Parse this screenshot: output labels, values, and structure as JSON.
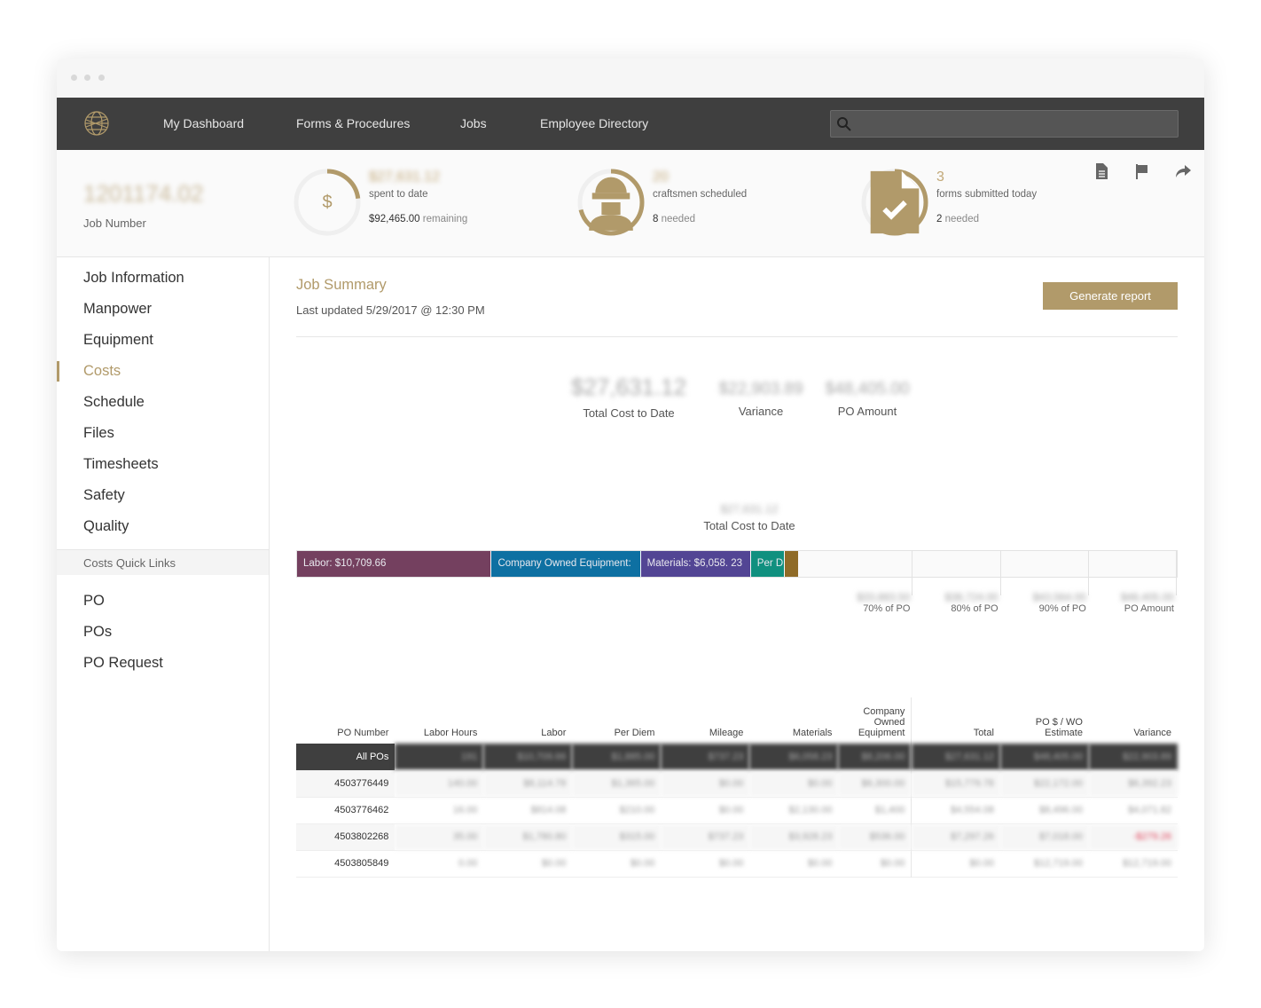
{
  "nav": {
    "items": [
      "My Dashboard",
      "Forms & Procedures",
      "Jobs",
      "Employee Directory"
    ],
    "search_placeholder": ""
  },
  "header": {
    "job_number": "1201174.02",
    "job_number_label": "Job Number",
    "stats": [
      {
        "icon": "dollar-icon",
        "value": "$27,631.12",
        "label": "spent to date",
        "extra_value": "$92,465.00",
        "extra_label": "remaining",
        "progress": 0.23
      },
      {
        "icon": "worker-icon",
        "value": "20",
        "label": "craftsmen scheduled",
        "extra_value": "8",
        "extra_label": "needed",
        "progress": 0.71
      },
      {
        "icon": "form-check-icon",
        "value": "3",
        "label": "forms submitted today",
        "extra_value": "2",
        "extra_label": "needed",
        "progress": 0.6
      }
    ],
    "actions": [
      "document-icon",
      "flag-icon",
      "share-icon"
    ]
  },
  "sidebar": {
    "items": [
      "Job Information",
      "Manpower",
      "Equipment",
      "Costs",
      "Schedule",
      "Files",
      "Timesheets",
      "Safety",
      "Quality"
    ],
    "active": "Costs",
    "quick_links_label": "Costs Quick Links",
    "quick_links": [
      "PO",
      "POs",
      "PO Request"
    ]
  },
  "main": {
    "title": "Job Summary",
    "updated": "Last updated 5/29/2017 @ 12:30 PM",
    "generate_label": "Generate report",
    "kpis": [
      {
        "value": "$27,631.12",
        "label": "Total Cost to Date"
      },
      {
        "value": "$22,903.89",
        "label": "Variance"
      },
      {
        "value": "$48,405.00",
        "label": "PO Amount"
      }
    ]
  },
  "chart_data": {
    "type": "bar",
    "stacked": true,
    "orientation": "horizontal",
    "total_value": "$27,631.12",
    "total_label": "Total Cost to Date",
    "xlim": [
      0,
      48405
    ],
    "series": [
      {
        "name": "Labor",
        "label": "Labor: $10,709.66",
        "value": 10709.66,
        "color": "#74405f"
      },
      {
        "name": "Company Owned Equipment",
        "label": "Company Owned Equipment:",
        "value": 8206.0,
        "color": "#0e70a2"
      },
      {
        "name": "Materials",
        "label": "Materials: $6,058. 23",
        "value": 6058.23,
        "color": "#524594"
      },
      {
        "name": "Per Diem",
        "label": "Per D",
        "value": 1885.0,
        "color": "#10907f"
      },
      {
        "name": "Mileage",
        "label": "",
        "value": 737.23,
        "color": "#8f6b28"
      }
    ],
    "thresholds": [
      {
        "value": 33883.5,
        "value_label": "$33,883.50",
        "label": "70% of PO"
      },
      {
        "value": 38724.0,
        "value_label": "$38,724.00",
        "label": "80% of PO"
      },
      {
        "value": 43564.0,
        "value_label": "$43,564.00",
        "label": "90% of PO"
      },
      {
        "value": 48405.0,
        "value_label": "$48,405.00",
        "label": "PO Amount"
      }
    ]
  },
  "table": {
    "headers": [
      "PO Number",
      "Labor Hours",
      "Labor",
      "Per Diem",
      "Mileage",
      "Materials",
      "Company Owned Equipment",
      "Total",
      "PO $ / WO Estimate",
      "Variance"
    ],
    "rows": [
      [
        "All POs",
        "191",
        "$10,709.66",
        "$1,885.00",
        "$737.23",
        "$6,058.23",
        "$8,206.00",
        "$27,631.12",
        "$48,405.00",
        "$22,903.89"
      ],
      [
        "4503776449",
        "140.00",
        "$8,114.78",
        "$1,365.00",
        "$0.00",
        "$0.00",
        "$6,300.00",
        "$15,779.78",
        "$22,172.00",
        "$6,392.23"
      ],
      [
        "4503776462",
        "16.00",
        "$814.08",
        "$210.00",
        "$0.00",
        "$2,130.00",
        "$1,400",
        "$4,554.08",
        "$8,496.00",
        "$4,071.82"
      ],
      [
        "4503802268",
        "35.00",
        "$1,780.80",
        "$315.00",
        "$737.23",
        "$3,928.23",
        "$536.00",
        "$7,297.26",
        "$7,018.00",
        "-$279.26"
      ],
      [
        "4503805849",
        "0.00",
        "$0.00",
        "$0.00",
        "$0.00",
        "$0.00",
        "$0.00",
        "$0.00",
        "$12,719.00",
        "$12,719.00"
      ]
    ],
    "negative_color": "#e0435a"
  }
}
